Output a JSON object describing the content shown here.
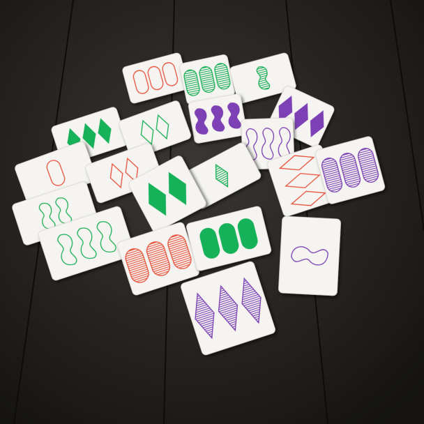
{
  "scene": {
    "subject": "set-card-game-layout",
    "surface": "dark-wooden-table"
  },
  "colors": {
    "red": "#e8553c",
    "green": "#18b25a",
    "purple": "#7d3fb5",
    "card": "#f5f4f1",
    "table": "#1c1a18"
  },
  "cards": [
    {
      "name": "card-red-oval-outline-3",
      "color": "red",
      "shape": "oval",
      "count": 3,
      "fill": "outline"
    },
    {
      "name": "card-green-oval-stripe-3",
      "color": "green",
      "shape": "oval",
      "count": 3,
      "fill": "striped"
    },
    {
      "name": "card-green-squiggle-stripe-1",
      "color": "green",
      "shape": "squiggle",
      "count": 1,
      "fill": "striped"
    },
    {
      "name": "card-purple-squiggle-solid-3",
      "color": "purple",
      "shape": "squiggle",
      "count": 3,
      "fill": "solid"
    },
    {
      "name": "card-purple-diamond-solid-3",
      "color": "purple",
      "shape": "diamond",
      "count": 3,
      "fill": "solid"
    },
    {
      "name": "card-green-diamond-solid-3",
      "color": "green",
      "shape": "diamond",
      "count": 3,
      "fill": "solid"
    },
    {
      "name": "card-green-diamond-outline-2",
      "color": "green",
      "shape": "diamond",
      "count": 2,
      "fill": "outline"
    },
    {
      "name": "card-purple-squiggle-outline-3",
      "color": "purple",
      "shape": "squiggle",
      "count": 3,
      "fill": "outline"
    },
    {
      "name": "card-red-oval-outline-1",
      "color": "red",
      "shape": "oval",
      "count": 1,
      "fill": "outline"
    },
    {
      "name": "card-red-diamond-outline-2",
      "color": "red",
      "shape": "diamond",
      "count": 2,
      "fill": "outline"
    },
    {
      "name": "card-green-diamond-stripe-1",
      "color": "green",
      "shape": "diamond",
      "count": 1,
      "fill": "striped"
    },
    {
      "name": "card-red-diamond-outline-3",
      "color": "red",
      "shape": "diamond",
      "count": 3,
      "fill": "outline"
    },
    {
      "name": "card-purple-oval-stripe-3",
      "color": "purple",
      "shape": "oval",
      "count": 3,
      "fill": "striped"
    },
    {
      "name": "card-green-squiggle-outline-2",
      "color": "green",
      "shape": "squiggle",
      "count": 2,
      "fill": "outline"
    },
    {
      "name": "card-green-diamond-solid-2",
      "color": "green",
      "shape": "diamond",
      "count": 2,
      "fill": "solid"
    },
    {
      "name": "card-green-squiggle-outline-3",
      "color": "green",
      "shape": "squiggle",
      "count": 3,
      "fill": "outline"
    },
    {
      "name": "card-red-oval-stripe-3",
      "color": "red",
      "shape": "oval",
      "count": 3,
      "fill": "striped"
    },
    {
      "name": "card-green-oval-solid-3",
      "color": "green",
      "shape": "oval",
      "count": 3,
      "fill": "solid"
    },
    {
      "name": "card-purple-squiggle-outline-1",
      "color": "purple",
      "shape": "squiggle",
      "count": 1,
      "fill": "outline"
    },
    {
      "name": "card-purple-diamond-stripe-3",
      "color": "purple",
      "shape": "diamond",
      "count": 3,
      "fill": "striped"
    }
  ]
}
